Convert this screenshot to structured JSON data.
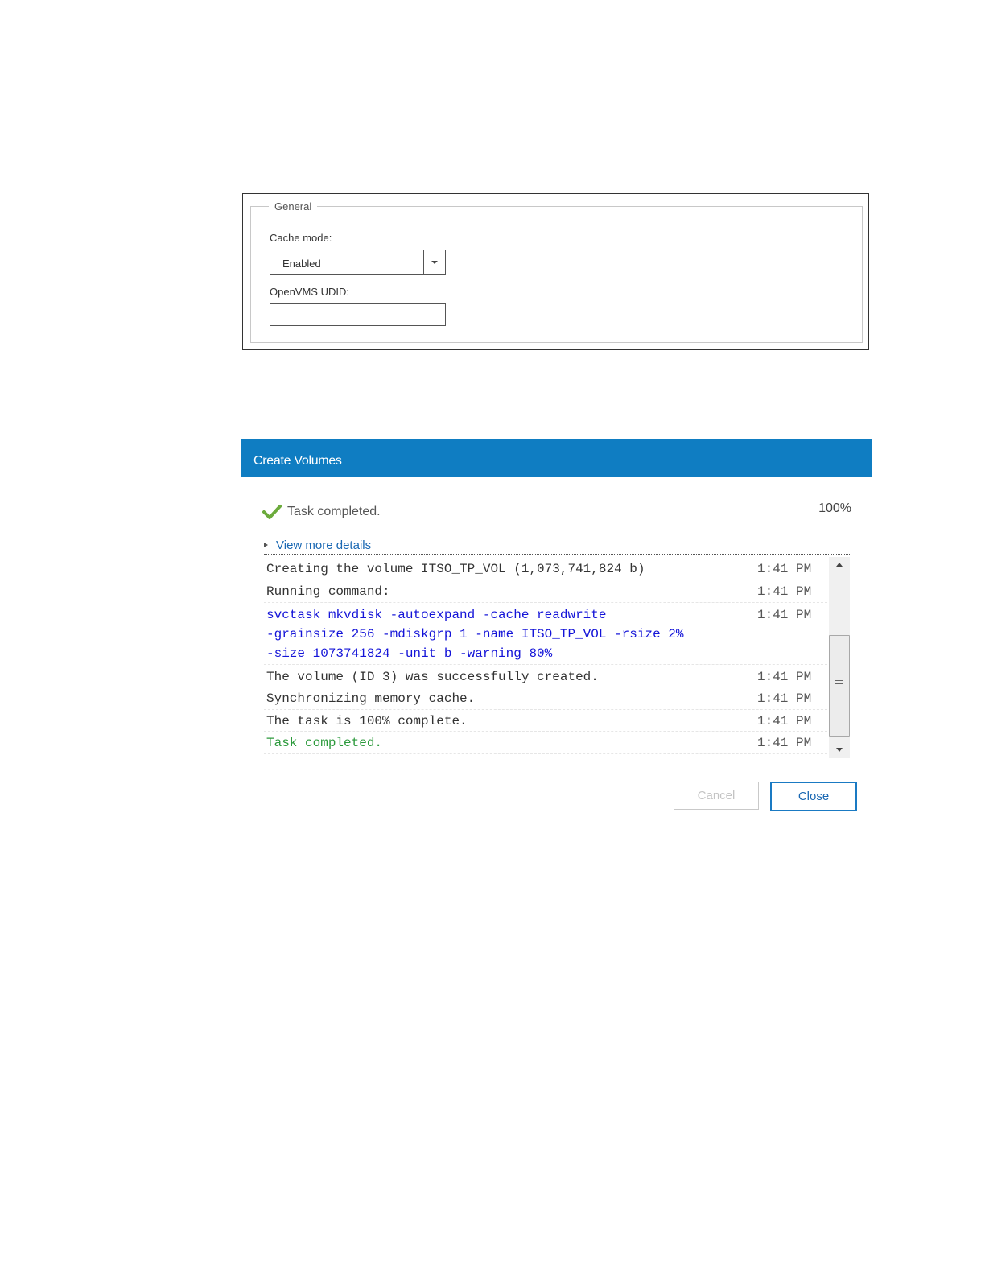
{
  "general_panel": {
    "legend": "General",
    "cache_mode": {
      "label": "Cache mode:",
      "selected": "Enabled"
    },
    "openvms_udid": {
      "label": "OpenVMS UDID:",
      "value": "",
      "placeholder": ""
    }
  },
  "dialog": {
    "title": "Create Volumes",
    "status_text": "Task completed.",
    "progress_text": "100%",
    "details_link": "View more details",
    "log": [
      {
        "message": "Creating the volume ITSO_TP_VOL (1,073,741,824 b)",
        "time": "1:41 PM",
        "type": "normal"
      },
      {
        "message": "Running command:",
        "time": "1:41 PM",
        "type": "normal"
      },
      {
        "message": "svctask mkvdisk -autoexpand -cache readwrite\n-grainsize 256 -mdiskgrp 1 -name ITSO_TP_VOL -rsize 2%\n-size 1073741824 -unit b -warning 80%",
        "time": "1:41 PM",
        "type": "command"
      },
      {
        "message": "The volume (ID 3) was successfully created.",
        "time": "1:41 PM",
        "type": "normal"
      },
      {
        "message": "Synchronizing memory cache.",
        "time": "1:41 PM",
        "type": "normal"
      },
      {
        "message": "The task is 100% complete.",
        "time": "1:41 PM",
        "type": "normal"
      },
      {
        "message": "Task completed.",
        "time": "1:41 PM",
        "type": "success"
      }
    ],
    "buttons": {
      "cancel": "Cancel",
      "close": "Close"
    }
  },
  "colors": {
    "header": "#0f7dc2",
    "link": "#1a68b3",
    "command_text": "#1414d8",
    "success_text": "#2c9a3c",
    "check_icon": "#6cab3c"
  }
}
